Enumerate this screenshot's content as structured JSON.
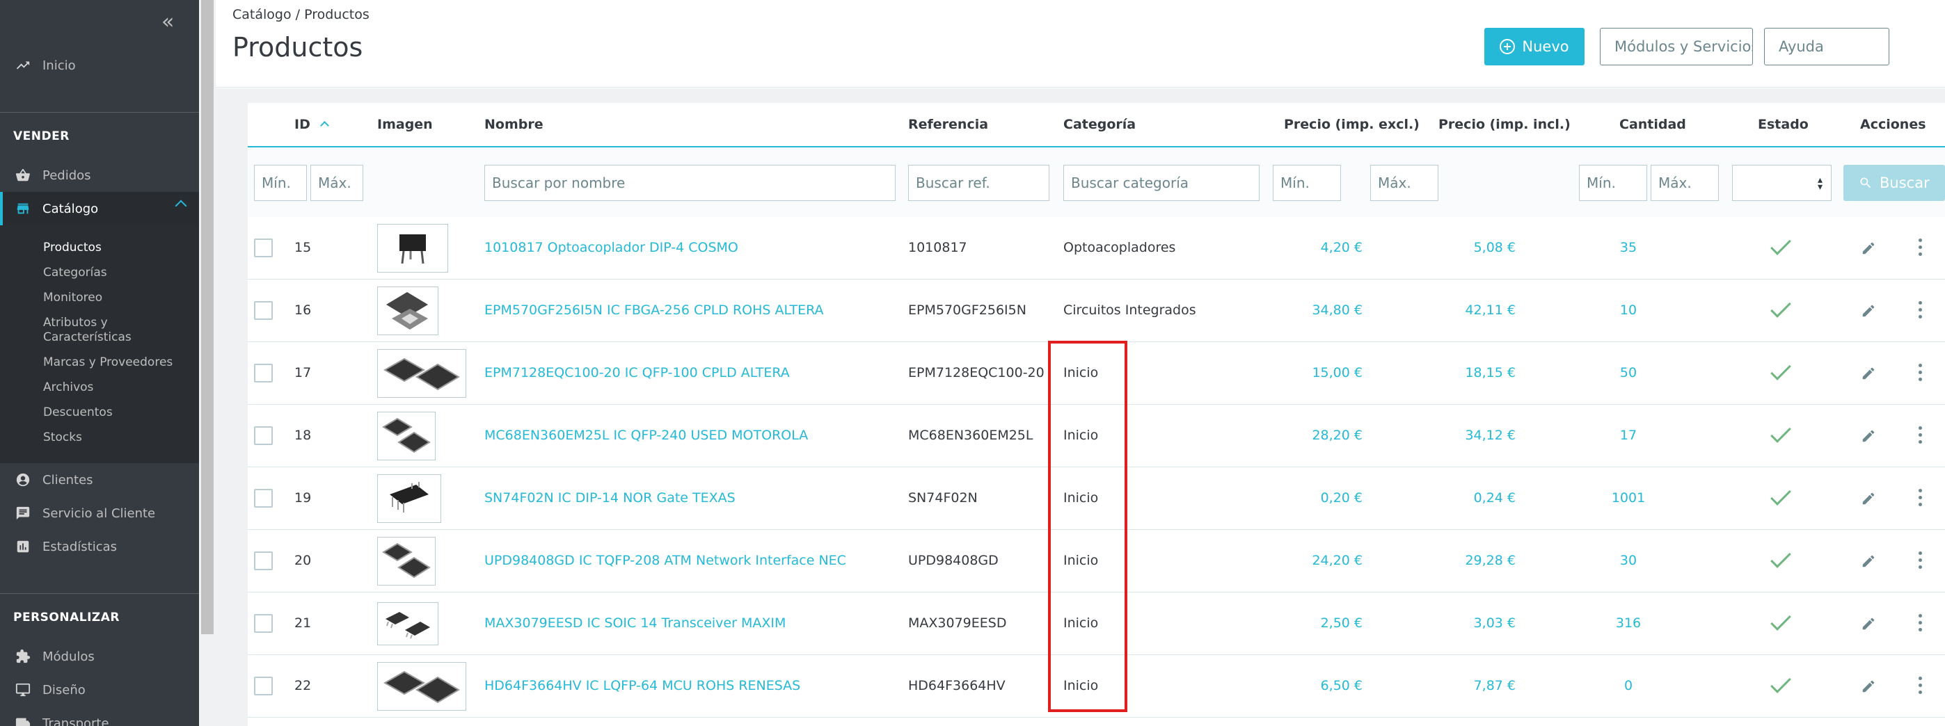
{
  "sidebar": {
    "collapse_glyph": "«",
    "home_label": "Inicio",
    "sections": {
      "sell": "VENDER",
      "customize": "PERSONALIZAR"
    },
    "items": {
      "orders": "Pedidos",
      "catalog": "Catálogo",
      "customers": "Clientes",
      "customer_service": "Servicio al Cliente",
      "stats": "Estadísticas",
      "modules": "Módulos",
      "design": "Diseño",
      "shipping": "Transporte"
    },
    "catalog_sub": [
      "Productos",
      "Categorías",
      "Monitoreo",
      "Atributos y",
      "Características",
      "Marcas y Proveedores",
      "Archivos",
      "Descuentos",
      "Stocks"
    ]
  },
  "header": {
    "breadcrumb": "Catálogo  /  Productos",
    "title": "Productos",
    "btn_new": "Nuevo",
    "btn_modules": "Módulos y Servicios recomendados",
    "btn_help": "Ayuda"
  },
  "table": {
    "headers": {
      "id": "ID",
      "image": "Imagen",
      "name": "Nombre",
      "reference": "Referencia",
      "category": "Categoría",
      "price_excl": "Precio (imp. excl.)",
      "price_incl": "Precio (imp. incl.)",
      "quantity": "Cantidad",
      "status": "Estado",
      "actions": "Acciones"
    },
    "filters": {
      "id_min": "Mín.",
      "id_max": "Máx.",
      "name": "Buscar por nombre",
      "reference": "Buscar ref.",
      "category": "Buscar categoría",
      "price_min": "Mín.",
      "price_max": "Máx.",
      "qty_min": "Mín.",
      "qty_max": "Máx.",
      "search_btn": "Buscar"
    },
    "rows": [
      {
        "id": "15",
        "name": "1010817 Optoacoplador DIP-4 COSMO",
        "reference": "1010817",
        "category": "Optoacopladores",
        "price_excl": "4,20 €",
        "price_incl": "5,08 €",
        "quantity": "35"
      },
      {
        "id": "16",
        "name": "EPM570GF256I5N IC FBGA-256 CPLD ROHS ALTERA",
        "reference": "EPM570GF256I5N",
        "category": "Circuitos Integrados",
        "price_excl": "34,80 €",
        "price_incl": "42,11 €",
        "quantity": "10"
      },
      {
        "id": "17",
        "name": "EPM7128EQC100-20 IC QFP-100 CPLD ALTERA",
        "reference": "EPM7128EQC100-20",
        "category": "Inicio",
        "price_excl": "15,00 €",
        "price_incl": "18,15 €",
        "quantity": "50"
      },
      {
        "id": "18",
        "name": "MC68EN360EM25L IC QFP-240 USED MOTOROLA",
        "reference": "MC68EN360EM25L",
        "category": "Inicio",
        "price_excl": "28,20 €",
        "price_incl": "34,12 €",
        "quantity": "17"
      },
      {
        "id": "19",
        "name": "SN74F02N IC DIP-14 NOR Gate TEXAS",
        "reference": "SN74F02N",
        "category": "Inicio",
        "price_excl": "0,20 €",
        "price_incl": "0,24 €",
        "quantity": "1001"
      },
      {
        "id": "20",
        "name": "UPD98408GD IC TQFP-208 ATM Network Interface NEC",
        "reference": "UPD98408GD",
        "category": "Inicio",
        "price_excl": "24,20 €",
        "price_incl": "29,28 €",
        "quantity": "30"
      },
      {
        "id": "21",
        "name": "MAX3079EESD IC SOIC 14 Transceiver MAXIM",
        "reference": "MAX3079EESD",
        "category": "Inicio",
        "price_excl": "2,50 €",
        "price_incl": "3,03 €",
        "quantity": "316"
      },
      {
        "id": "22",
        "name": "HD64F3664HV IC LQFP-64 MCU ROHS RENESAS",
        "reference": "HD64F3664HV",
        "category": "Inicio",
        "price_excl": "6,50 €",
        "price_incl": "7,87 €",
        "quantity": "0"
      }
    ]
  },
  "colors": {
    "accent": "#25b9d7",
    "sidebar": "#363a41",
    "success": "#70b580",
    "highlight": "#e02020"
  }
}
